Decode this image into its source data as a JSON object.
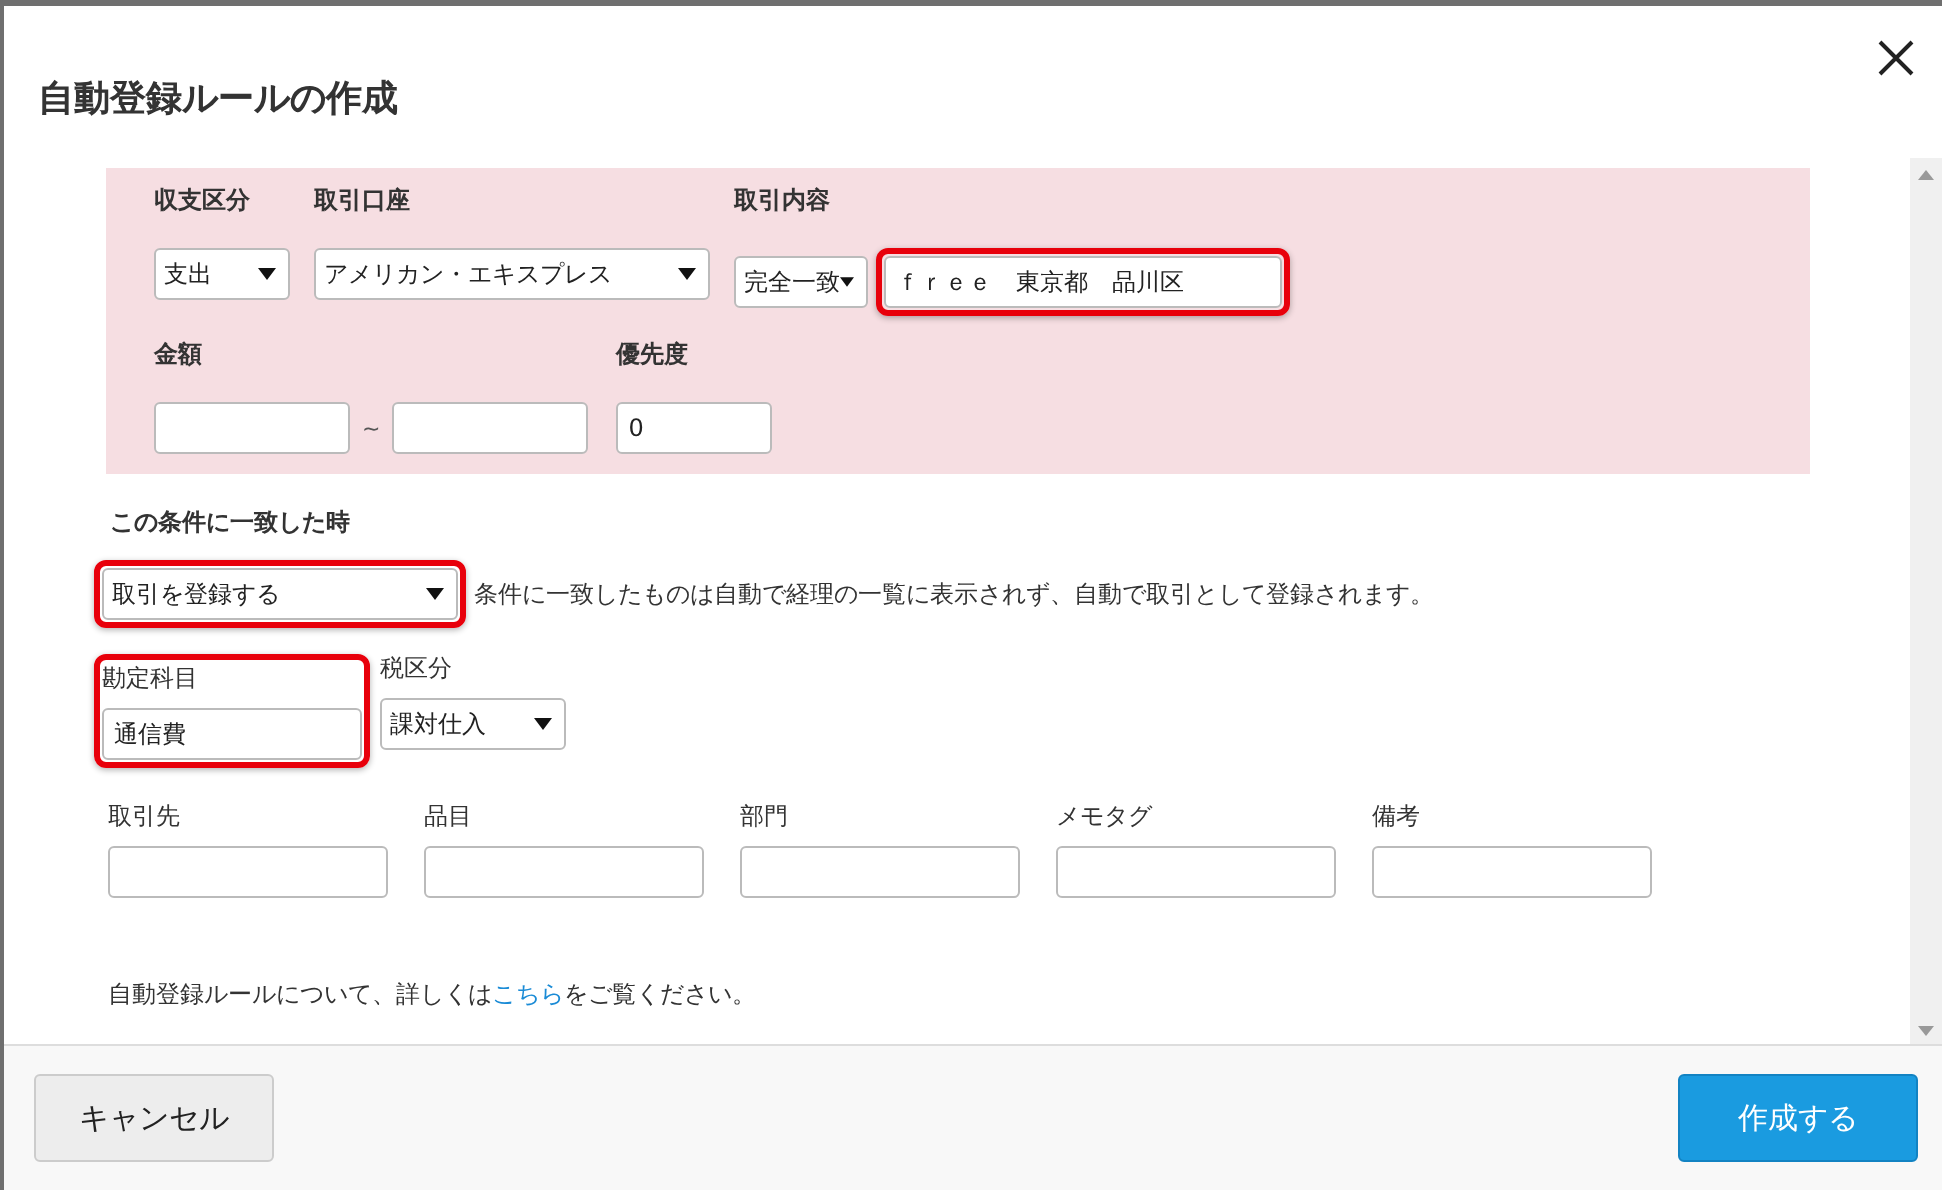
{
  "dialog": {
    "title": "自動登録ルールの作成"
  },
  "condition": {
    "type": {
      "label": "収支区分",
      "value": "支出"
    },
    "account": {
      "label": "取引口座",
      "value": "アメリカン・エキスプレス"
    },
    "content": {
      "label": "取引内容",
      "match": "完全一致",
      "text": "ｆｒｅｅ　東京都　品川区",
      "highlighted": true
    },
    "amount": {
      "label": "金額",
      "separator": "~"
    },
    "priority": {
      "label": "優先度",
      "value": "0"
    }
  },
  "action": {
    "heading": "この条件に一致した時",
    "select": {
      "value": "取引を登録する",
      "highlighted": true
    },
    "description": "条件に一致したものは自動で経理の一覧に表示されず、自動で取引として登録されます。",
    "account_item": {
      "label": "勘定科目",
      "value": "通信費",
      "highlighted": true
    },
    "tax": {
      "label": "税区分",
      "value": "課対仕入"
    },
    "optional_fields": [
      {
        "label": "取引先"
      },
      {
        "label": "品目"
      },
      {
        "label": "部門"
      },
      {
        "label": "メモタグ"
      },
      {
        "label": "備考"
      }
    ]
  },
  "help": {
    "before": "自動登録ルールについて、詳しくは",
    "link": "こちら",
    "after": "をご覧ください。"
  },
  "footer": {
    "cancel": "キャンセル",
    "submit": "作成する"
  }
}
